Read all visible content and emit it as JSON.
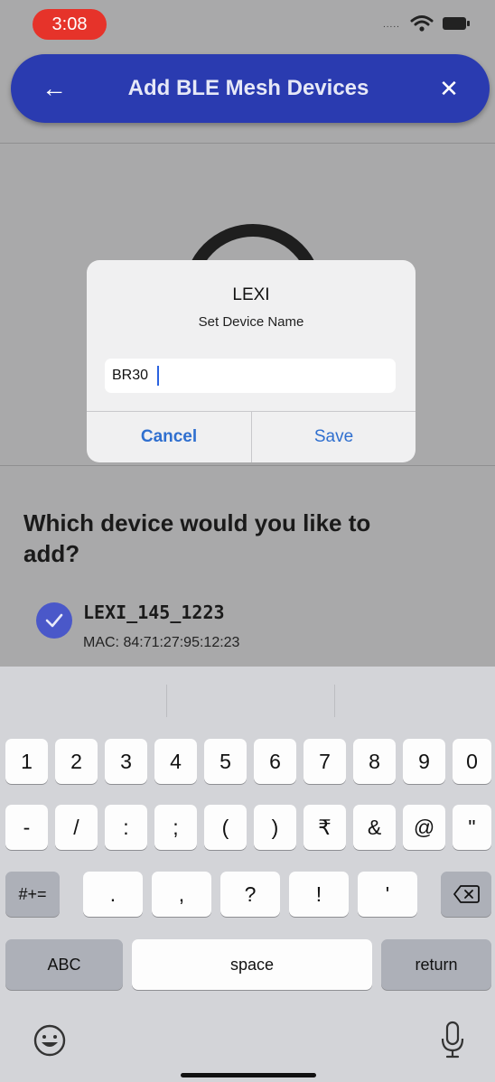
{
  "status": {
    "time": "3:08",
    "signal": "....."
  },
  "header": {
    "title": "Add BLE Mesh Devices",
    "back_icon": "←",
    "close_icon": "✕"
  },
  "content": {
    "question": "Which device would you like to add?",
    "device": {
      "name": "LEXI_145_1223",
      "mac": "MAC: 84:71:27:95:12:23",
      "selected": true
    }
  },
  "alert": {
    "title": "LEXI",
    "message": "Set Device Name",
    "input_value": "BR30",
    "cancel_label": "Cancel",
    "save_label": "Save"
  },
  "keyboard": {
    "row1": [
      "1",
      "2",
      "3",
      "4",
      "5",
      "6",
      "7",
      "8",
      "9",
      "0"
    ],
    "row2": [
      "-",
      "/",
      ":",
      ";",
      "(",
      ")",
      "₹",
      "&",
      "@",
      "\""
    ],
    "row3": [
      ".",
      ",",
      "?",
      "!",
      "'"
    ],
    "shift_label": "#+=",
    "abc_label": "ABC",
    "space_label": "space",
    "return_label": "return"
  },
  "colors": {
    "accent": "#2a3bb0",
    "link": "#2f6fcf",
    "time_pill": "#e6332a",
    "check": "#4a58c9"
  }
}
